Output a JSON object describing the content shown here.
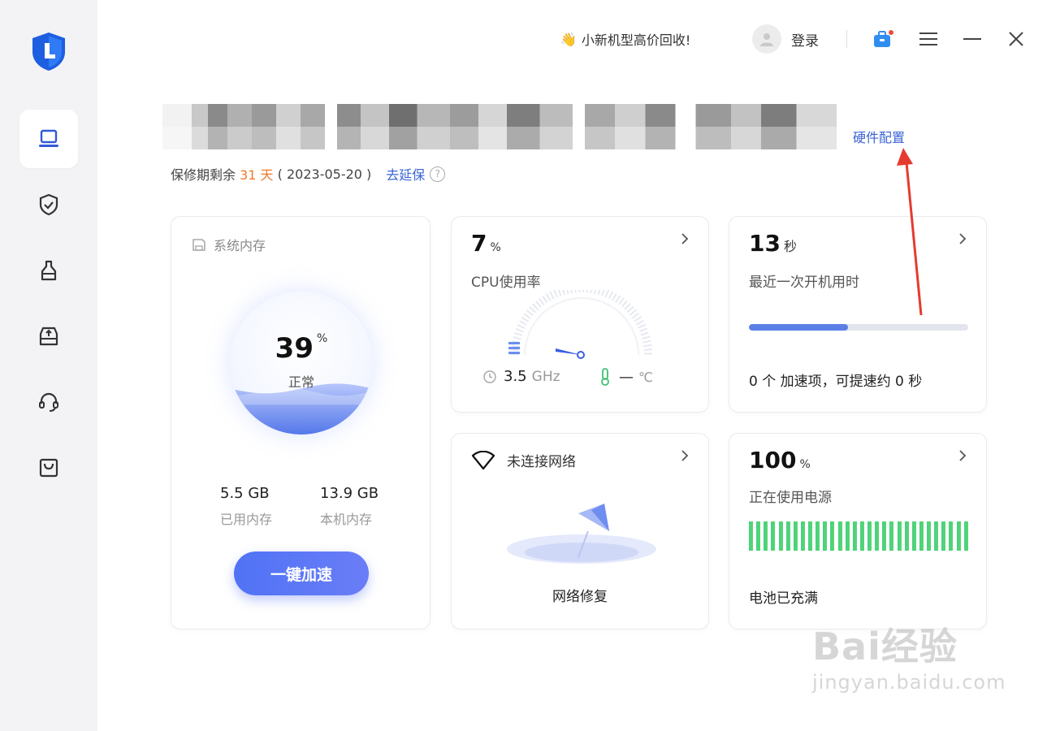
{
  "topbar": {
    "promo_text": "小新机型高价回收!",
    "login_label": "登录"
  },
  "device": {
    "hardware_link": "硬件配置",
    "warranty_prefix": "保修期剩余",
    "warranty_days": "31 天",
    "warranty_date": "( 2023-05-20 )",
    "extend_link": "去延保"
  },
  "memory": {
    "title": "系统内存",
    "percent": "39",
    "percent_unit": "%",
    "status": "正常",
    "used_value": "5.5 GB",
    "used_label": "已用内存",
    "total_value": "13.9 GB",
    "total_label": "本机内存",
    "boost_button": "一键加速",
    "fill_fraction": 0.39
  },
  "cpu": {
    "value": "7",
    "unit": "%",
    "label": "CPU使用率",
    "freq_value": "3.5",
    "freq_unit": "GHz",
    "temp_value": "—",
    "temp_unit": "℃"
  },
  "boot": {
    "value": "13",
    "unit": "秒",
    "label": "最近一次开机用时",
    "progress_fraction": 0.45,
    "summary": "0 个 加速项，可提速约 0 秒"
  },
  "network": {
    "status": "未连接网络",
    "repair_label": "网络修复"
  },
  "battery": {
    "value": "100",
    "unit": "%",
    "label": "正在使用电源",
    "status": "电池已充满",
    "level_fraction": 1.0
  },
  "watermark": {
    "brand": "Bai经验",
    "url": "jingyan.baidu.com"
  },
  "colors": {
    "accent": "#3b64d6",
    "orange": "#f07a2a",
    "battery_green": "#4ed37a",
    "arrow_red": "#e53b2e"
  }
}
